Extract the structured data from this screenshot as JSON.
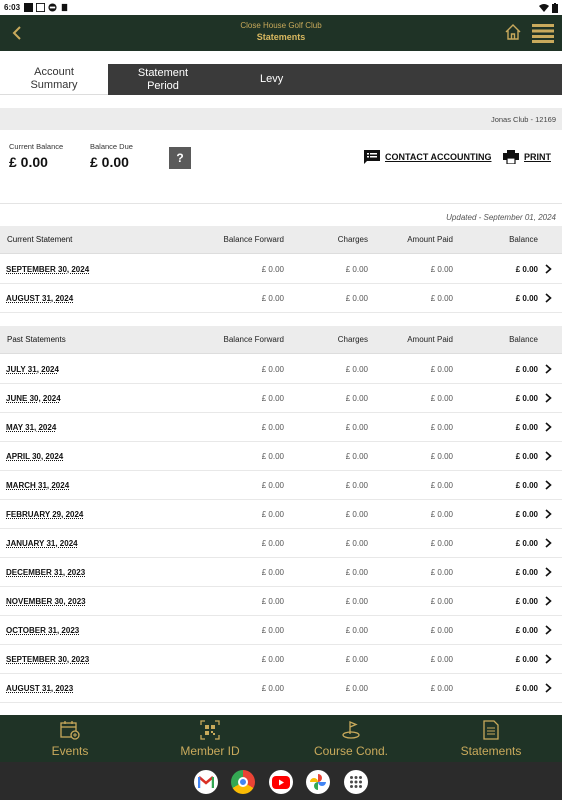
{
  "status_bar": {
    "time": "6:03"
  },
  "header": {
    "club_name": "Close House Golf Club",
    "page_title": "Statements"
  },
  "tabs": [
    {
      "label_line1": "Account",
      "label_line2": "Summary"
    },
    {
      "label_line1": "Statement",
      "label_line2": "Period"
    },
    {
      "label": "Levy"
    }
  ],
  "club_info": "Jonas Club - 12169",
  "balances": {
    "current_label": "Current Balance",
    "current_value": "£ 0.00",
    "due_label": "Balance Due",
    "due_value": "£ 0.00",
    "help": "?"
  },
  "actions": {
    "contact": "CONTACT ACCOUNTING",
    "print": "PRINT"
  },
  "updated": "Updated - September 01, 2024",
  "columns": {
    "balance_forward": "Balance Forward",
    "charges": "Charges",
    "amount_paid": "Amount Paid",
    "balance": "Balance"
  },
  "current_section": {
    "heading": "Current Statement",
    "rows": [
      {
        "date": "SEPTEMBER 30, 2024",
        "bf": "£ 0.00",
        "charges": "£ 0.00",
        "paid": "£ 0.00",
        "balance": "£ 0.00"
      },
      {
        "date": "AUGUST 31, 2024",
        "bf": "£ 0.00",
        "charges": "£ 0.00",
        "paid": "£ 0.00",
        "balance": "£ 0.00"
      }
    ]
  },
  "past_section": {
    "heading": "Past Statements",
    "rows": [
      {
        "date": "JULY 31, 2024",
        "bf": "£ 0.00",
        "charges": "£ 0.00",
        "paid": "£ 0.00",
        "balance": "£ 0.00"
      },
      {
        "date": "JUNE 30, 2024",
        "bf": "£ 0.00",
        "charges": "£ 0.00",
        "paid": "£ 0.00",
        "balance": "£ 0.00"
      },
      {
        "date": "MAY 31, 2024",
        "bf": "£ 0.00",
        "charges": "£ 0.00",
        "paid": "£ 0.00",
        "balance": "£ 0.00"
      },
      {
        "date": "APRIL 30, 2024",
        "bf": "£ 0.00",
        "charges": "£ 0.00",
        "paid": "£ 0.00",
        "balance": "£ 0.00"
      },
      {
        "date": "MARCH 31, 2024",
        "bf": "£ 0.00",
        "charges": "£ 0.00",
        "paid": "£ 0.00",
        "balance": "£ 0.00"
      },
      {
        "date": "FEBRUARY 29, 2024",
        "bf": "£ 0.00",
        "charges": "£ 0.00",
        "paid": "£ 0.00",
        "balance": "£ 0.00"
      },
      {
        "date": "JANUARY 31, 2024",
        "bf": "£ 0.00",
        "charges": "£ 0.00",
        "paid": "£ 0.00",
        "balance": "£ 0.00"
      },
      {
        "date": "DECEMBER 31, 2023",
        "bf": "£ 0.00",
        "charges": "£ 0.00",
        "paid": "£ 0.00",
        "balance": "£ 0.00"
      },
      {
        "date": "NOVEMBER 30, 2023",
        "bf": "£ 0.00",
        "charges": "£ 0.00",
        "paid": "£ 0.00",
        "balance": "£ 0.00"
      },
      {
        "date": "OCTOBER 31, 2023",
        "bf": "£ 0.00",
        "charges": "£ 0.00",
        "paid": "£ 0.00",
        "balance": "£ 0.00"
      },
      {
        "date": "SEPTEMBER 30, 2023",
        "bf": "£ 0.00",
        "charges": "£ 0.00",
        "paid": "£ 0.00",
        "balance": "£ 0.00"
      },
      {
        "date": "AUGUST 31, 2023",
        "bf": "£ 0.00",
        "charges": "£ 0.00",
        "paid": "£ 0.00",
        "balance": "£ 0.00"
      }
    ]
  },
  "bottom_nav": [
    {
      "label": "Events",
      "icon": "calendar-plus-icon"
    },
    {
      "label": "Member ID",
      "icon": "qr-code-icon"
    },
    {
      "label": "Course Cond.",
      "icon": "golf-flag-icon"
    },
    {
      "label": "Statements",
      "icon": "document-icon"
    }
  ],
  "dock_apps": [
    "gmail-icon",
    "chrome-icon",
    "youtube-icon",
    "photos-icon",
    "app-drawer-icon"
  ],
  "colors": {
    "brand_dark_green": "#1f3326",
    "gold": "#c9aa5c",
    "tab_dark": "#3a3a3a"
  }
}
